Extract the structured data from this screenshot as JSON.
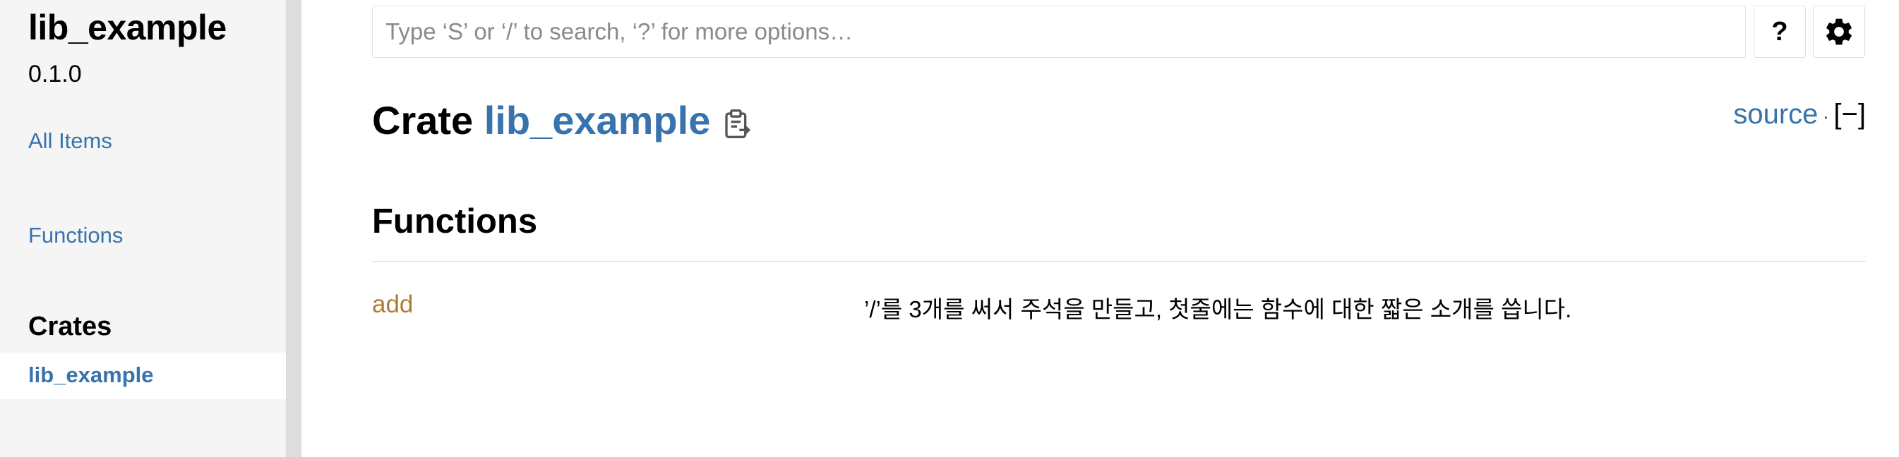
{
  "sidebar": {
    "crate_name": "lib_example",
    "version": "0.1.0",
    "all_items_link": "All Items",
    "functions_link": "Functions",
    "crates_heading": "Crates",
    "crates": [
      "lib_example"
    ]
  },
  "search": {
    "placeholder": "Type ‘S’ or ‘/’ to search, ‘?’ for more options…",
    "value": ""
  },
  "toolbar": {
    "help_label": "?",
    "settings_icon": "gear-icon"
  },
  "main": {
    "title_prefix": "Crate ",
    "crate_name": "lib_example",
    "copy_icon": "clipboard-icon",
    "source_link": "source",
    "separator": "·",
    "collapse_toggle": "[−]",
    "sections": [
      {
        "heading": "Functions",
        "items": [
          {
            "name": "add",
            "description": "’/’를 3개를 써서 주석을 만들고, 첫줄에는 함수에 대한 짧은 소개를 씁니다."
          }
        ]
      }
    ]
  },
  "colors": {
    "link": "#3873ad",
    "function": "#ad7c37",
    "sidebar_bg": "#f5f5f5",
    "resizer": "#dddddd"
  }
}
